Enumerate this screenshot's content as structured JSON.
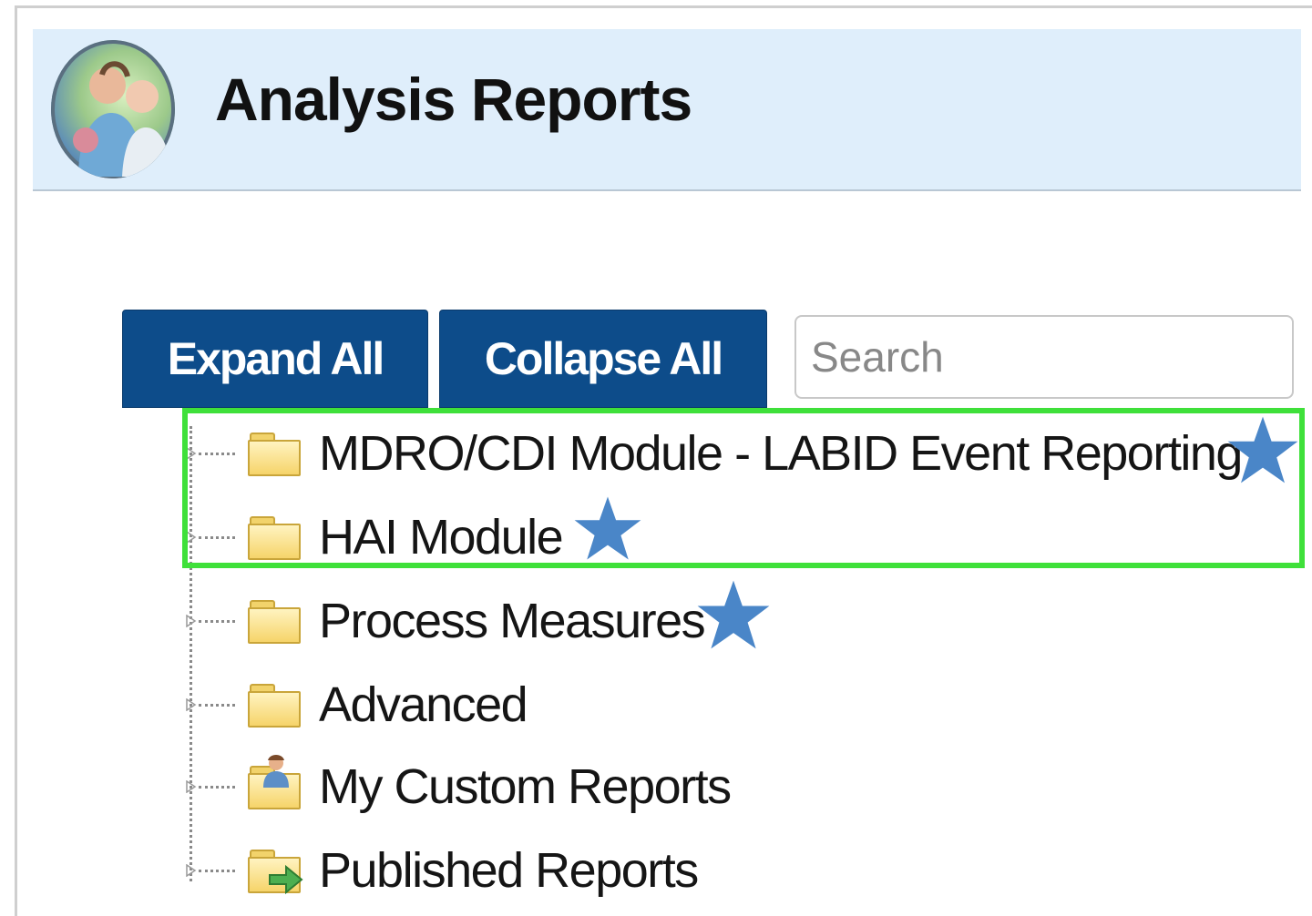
{
  "header": {
    "title": "Analysis Reports",
    "avatar_icon": "people-photo-avatar-icon"
  },
  "toolbar": {
    "expand_label": "Expand All",
    "collapse_label": "Collapse All",
    "search_placeholder": "Search",
    "button_color": "#0d4c8a"
  },
  "tree": {
    "items": [
      {
        "label": "MDRO/CDI Module - LABID Event Reporting",
        "icon": "folder-icon",
        "starred": true
      },
      {
        "label": "HAI Module",
        "icon": "folder-icon",
        "starred": true
      },
      {
        "label": "Process Measures",
        "icon": "folder-icon",
        "starred": true
      },
      {
        "label": "Advanced",
        "icon": "folder-icon",
        "starred": false
      },
      {
        "label": "My Custom Reports",
        "icon": "folder-user-icon",
        "starred": false
      },
      {
        "label": "Published Reports",
        "icon": "folder-share-icon",
        "starred": false
      }
    ]
  },
  "annotations": {
    "highlight_color": "#3fe03a",
    "star_color": "#4a86c8"
  }
}
